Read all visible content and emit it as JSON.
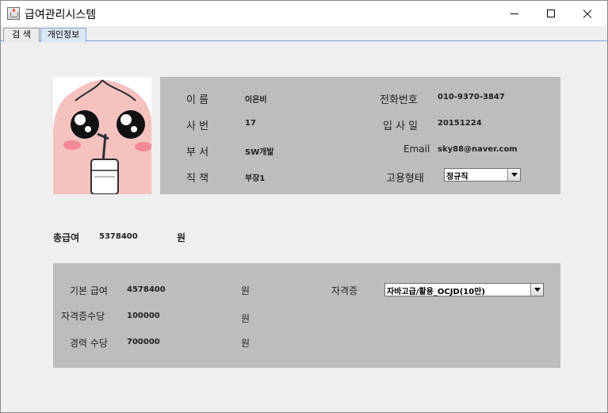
{
  "window": {
    "title": "급여관리시스템"
  },
  "tabs": [
    {
      "label": "검  색"
    },
    {
      "label": "개인정보",
      "selected": true
    }
  ],
  "profile": {
    "photo_icon": "peach-character-image",
    "name_label": "이     름",
    "name_value": "이은비",
    "id_label": "사     번",
    "id_value": "17",
    "dept_label": "부     서",
    "dept_value": "SW개발",
    "position_label": "직     책",
    "position_value": "부장1",
    "phone_label": "전화번호",
    "phone_value": "010-9370-3847",
    "join_label": "입 사 일",
    "join_value": "20151224",
    "email_label": "Email",
    "email_value": "sky88@naver.com",
    "employment_label": "고용형태",
    "employment_value": "정규직"
  },
  "total": {
    "label": "총급여",
    "value": "5378400",
    "unit": "원"
  },
  "salary": {
    "base_label": "기본 급여",
    "base_value": "4578400",
    "base_unit": "원",
    "cert_allowance_label": "자격증수당",
    "cert_allowance_value": "100000",
    "cert_allowance_unit": "원",
    "career_allowance_label": "경력 수당",
    "career_allowance_value": "700000",
    "career_allowance_unit": "원",
    "cert_label": "자격증",
    "cert_value": "자바고급/활용_OCJD(10만)"
  },
  "colors": {
    "panel": "#bdbdbd",
    "background": "#efefef",
    "selected_tab": "#dbe6f4"
  }
}
